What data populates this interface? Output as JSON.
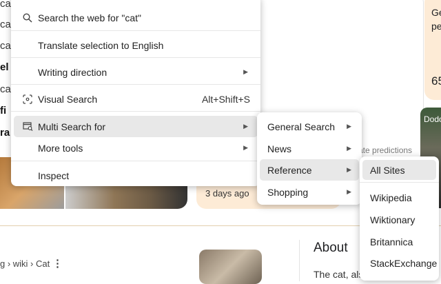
{
  "background": {
    "left_fragments": [
      "ca",
      "ca",
      "ca",
      "el",
      "ca",
      "fi",
      "ra"
    ],
    "right_card_lines": [
      "Ge",
      "pe",
      "65"
    ],
    "predictions_text": "ate predictions",
    "news_time": "3 days ago",
    "video_label": "Dodo",
    "breadcrumb": "g › wiki › Cat",
    "about_title": "About",
    "about_text": "The cat, als"
  },
  "context_menu": {
    "items": [
      {
        "label": "Search the web for \"cat\"",
        "icon": "search-icon"
      },
      {
        "label": "Translate selection to English"
      },
      {
        "label": "Writing direction",
        "submenu": true
      },
      {
        "label": "Visual Search",
        "icon": "visual-search-icon",
        "shortcut": "Alt+Shift+S"
      },
      {
        "label": "Multi Search for",
        "icon": "multi-search-icon",
        "submenu": true,
        "highlighted": true
      },
      {
        "label": "More tools",
        "submenu": true
      },
      {
        "label": "Inspect"
      }
    ]
  },
  "multi_search_submenu": {
    "items": [
      "General Search",
      "News",
      "Reference",
      "Shopping"
    ],
    "highlighted": "Reference"
  },
  "reference_submenu": {
    "items": [
      "All Sites",
      "Wikipedia",
      "Wiktionary",
      "Britannica",
      "StackExchange"
    ],
    "highlighted": "All Sites"
  },
  "colors": {
    "highlight": "#e8e8e8",
    "peach": "#fdebd6",
    "divider": "#e2cfae"
  }
}
